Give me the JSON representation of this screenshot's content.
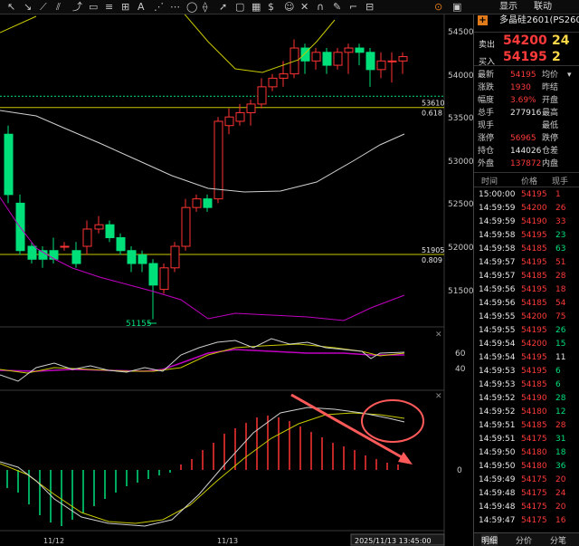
{
  "symbol": {
    "name": "多晶硅2601(PS2601"
  },
  "toolbar": {
    "menu_display": "显示",
    "menu_link": "联动"
  },
  "orderbook": {
    "ask": {
      "label": "卖出",
      "price": "54200",
      "volume": "24"
    },
    "bid": {
      "label": "买入",
      "price": "54195",
      "volume": "2"
    }
  },
  "quote": {
    "rows": [
      {
        "label": "最新",
        "value": "54195",
        "label2": "均价",
        "value2": ""
      },
      {
        "label": "涨跌",
        "value": "1930",
        "label2": "昨结",
        "value2": ""
      },
      {
        "label": "幅度",
        "value": "3.69%",
        "label2": "开盘",
        "value2": ""
      },
      {
        "label": "总手",
        "value": "277916",
        "label2": "最高",
        "value2": ""
      },
      {
        "label": "现手",
        "value": "",
        "label2": "最低",
        "value2": ""
      },
      {
        "label": "涨停",
        "value": "56965",
        "label2": "跌停",
        "value2": ""
      },
      {
        "label": "持仓",
        "value": "144026",
        "label2": "仓差",
        "value2": ""
      },
      {
        "label": "外盘",
        "value": "137872",
        "label2": "内盘",
        "value2": ""
      }
    ]
  },
  "trades": {
    "headers": [
      "时间",
      "价格",
      "现手"
    ],
    "rows": [
      {
        "time": "15:00:00",
        "price": "54195",
        "vol": "1",
        "dir": "up"
      },
      {
        "time": "14:59:59",
        "price": "54200",
        "vol": "26",
        "dir": "up"
      },
      {
        "time": "14:59:59",
        "price": "54190",
        "vol": "33",
        "dir": "up"
      },
      {
        "time": "14:59:58",
        "price": "54195",
        "vol": "23",
        "dir": "down"
      },
      {
        "time": "14:59:58",
        "price": "54185",
        "vol": "63",
        "dir": "down"
      },
      {
        "time": "14:59:57",
        "price": "54195",
        "vol": "51",
        "dir": "up"
      },
      {
        "time": "14:59:57",
        "price": "54185",
        "vol": "28",
        "dir": "up"
      },
      {
        "time": "14:59:56",
        "price": "54195",
        "vol": "18",
        "dir": "up"
      },
      {
        "time": "14:59:56",
        "price": "54185",
        "vol": "54",
        "dir": "up"
      },
      {
        "time": "14:59:55",
        "price": "54200",
        "vol": "75",
        "dir": "up"
      },
      {
        "time": "14:59:55",
        "price": "54195",
        "vol": "26",
        "dir": "down"
      },
      {
        "time": "14:59:54",
        "price": "54200",
        "vol": "15",
        "dir": "down"
      },
      {
        "time": "14:59:54",
        "price": "54195",
        "vol": "11",
        "dir": "neutral"
      },
      {
        "time": "14:59:53",
        "price": "54195",
        "vol": "6",
        "dir": "down"
      },
      {
        "time": "14:59:53",
        "price": "54185",
        "vol": "6",
        "dir": "down"
      },
      {
        "time": "14:59:52",
        "price": "54190",
        "vol": "28",
        "dir": "down"
      },
      {
        "time": "14:59:52",
        "price": "54180",
        "vol": "12",
        "dir": "down"
      },
      {
        "time": "14:59:51",
        "price": "54185",
        "vol": "28",
        "dir": "up"
      },
      {
        "time": "14:59:51",
        "price": "54175",
        "vol": "31",
        "dir": "down"
      },
      {
        "time": "14:59:50",
        "price": "54180",
        "vol": "18",
        "dir": "down"
      },
      {
        "time": "14:59:50",
        "price": "54180",
        "vol": "36",
        "dir": "down"
      },
      {
        "time": "14:59:49",
        "price": "54175",
        "vol": "20",
        "dir": "up"
      },
      {
        "time": "14:59:48",
        "price": "54175",
        "vol": "24",
        "dir": "up"
      },
      {
        "time": "14:59:48",
        "price": "54175",
        "vol": "20",
        "dir": "up"
      },
      {
        "time": "14:59:47",
        "price": "54175",
        "vol": "16",
        "dir": "up"
      }
    ]
  },
  "tabs": [
    {
      "label": "明细"
    },
    {
      "label": "分价"
    },
    {
      "label": "分笔"
    }
  ],
  "chart": {
    "price_ticks": [
      "54500",
      "54000",
      "53500",
      "53000",
      "52500",
      "52000",
      "51500"
    ],
    "fib_high": {
      "price": "53610",
      "ratio": "0.618"
    },
    "fib_low": {
      "price": "51905",
      "ratio": "0.809"
    },
    "low_mark": "51155",
    "osc_ticks": [
      "60",
      "40"
    ],
    "macd_zero": "0",
    "date_labels": [
      "11/12",
      "11/13"
    ],
    "cursor_time": "2025/11/13 13:45:00",
    "colors": {
      "up": "#ff3333",
      "down": "#00e07a",
      "ma_yellow": "#c8c800",
      "ma_white": "#d0d0d0",
      "ma_purple": "#c000c0",
      "annot": "#ff5a5a"
    }
  }
}
